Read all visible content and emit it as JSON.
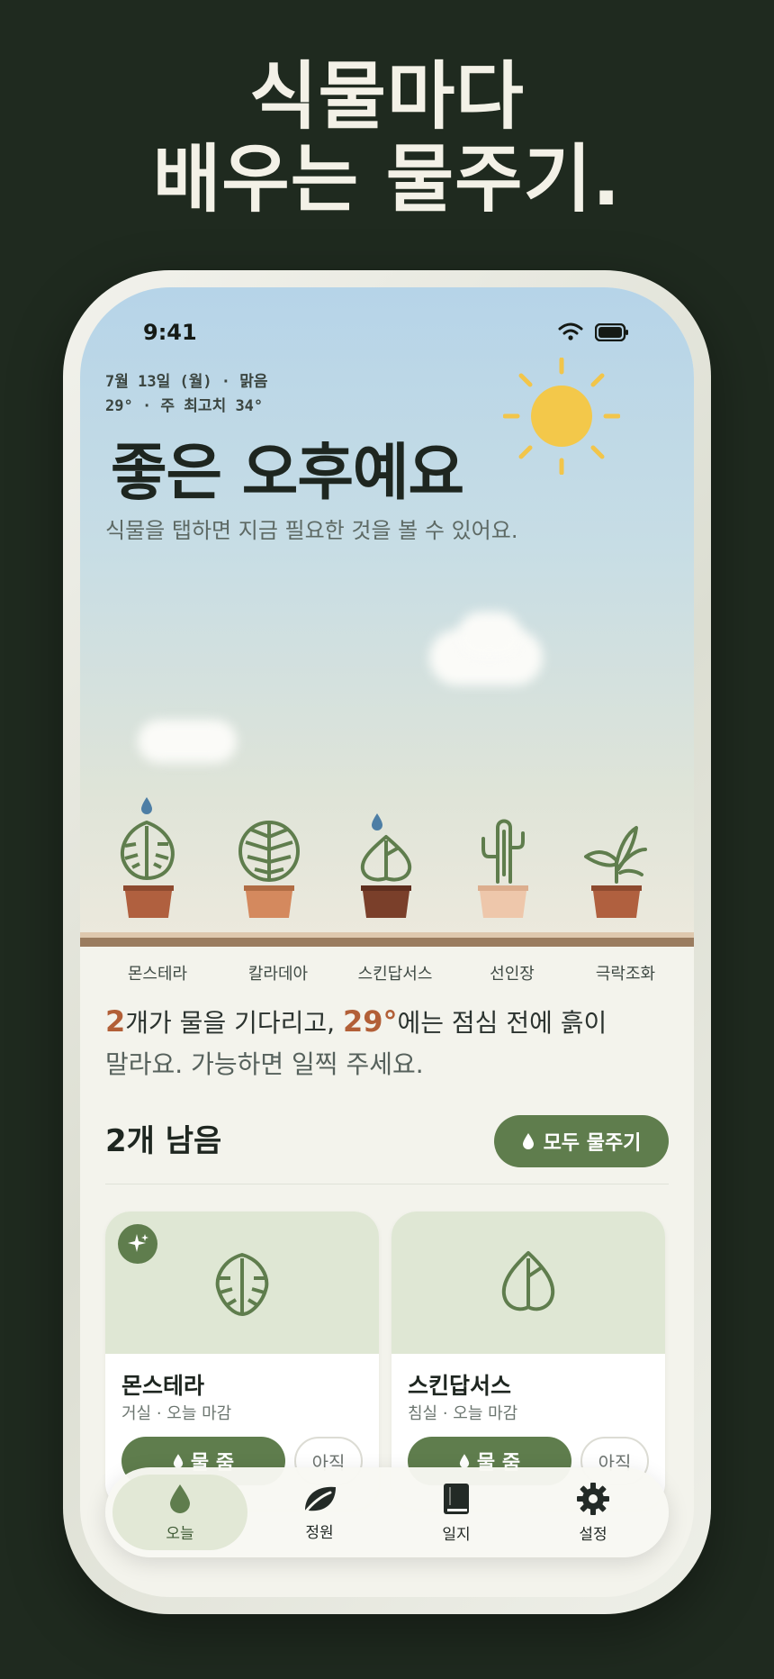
{
  "headline": {
    "line1": "식물마다",
    "line2": "배우는 물주기."
  },
  "status": {
    "time": "9:41"
  },
  "weather": {
    "line1": "7월 13일 (월) · 맑음",
    "line2": "29° · 주 최고치 34°"
  },
  "greeting": "좋은 오후예요",
  "subtext": "식물을 탭하면 지금 필요한 것을 볼 수 있어요.",
  "plants": [
    {
      "name": "몬스테라",
      "icon": "monstera-leaf-icon",
      "needs_water": true,
      "pot_color": "#b0603f"
    },
    {
      "name": "칼라데아",
      "icon": "calathea-leaf-icon",
      "needs_water": false,
      "pot_color": "#d4895e"
    },
    {
      "name": "스킨답서스",
      "icon": "pothos-leaf-icon",
      "needs_water": true,
      "pot_color": "#7a3f2a"
    },
    {
      "name": "선인장",
      "icon": "cactus-icon",
      "needs_water": false,
      "pot_color": "#eec7ab"
    },
    {
      "name": "극락조화",
      "icon": "bird-of-paradise-icon",
      "needs_water": false,
      "pot_color": "#b0603f"
    }
  ],
  "summary": {
    "count": "2",
    "part1": "개가 물을 기다리고, ",
    "temp": "29°",
    "part2": "에는 점심 전에 흙이",
    "part3": "말라요. 가능하면 일찍 주세요."
  },
  "remaining": "2개 남음",
  "water_all_label": "모두 물주기",
  "cards": [
    {
      "title": "몬스테라",
      "subtitle": "거실 · 오늘 마감",
      "primary": "물 줌",
      "secondary": "아직",
      "icon": "monstera-leaf-icon",
      "sparkle": true
    },
    {
      "title": "스킨답서스",
      "subtitle": "침실 · 오늘 마감",
      "primary": "물 줌",
      "secondary": "아직",
      "icon": "pothos-leaf-icon",
      "sparkle": false
    }
  ],
  "tabs": [
    {
      "label": "오늘",
      "icon": "droplet-icon",
      "active": true
    },
    {
      "label": "정원",
      "icon": "leaf-icon",
      "active": false
    },
    {
      "label": "일지",
      "icon": "book-icon",
      "active": false
    },
    {
      "label": "설정",
      "icon": "gear-icon",
      "active": false
    }
  ],
  "colors": {
    "accent": "#5f7d4d",
    "highlight": "#b25f37",
    "background": "#1f2a1f"
  }
}
